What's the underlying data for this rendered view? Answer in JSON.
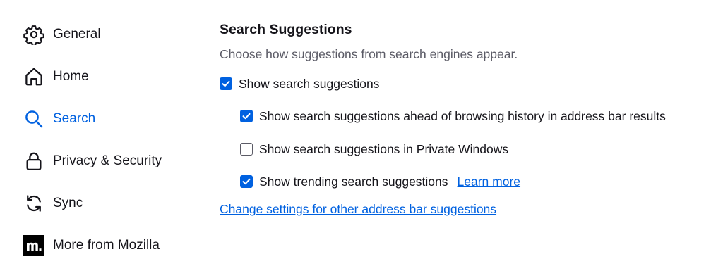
{
  "sidebar": {
    "items": [
      {
        "label": "General",
        "icon": "gear-icon",
        "selected": false
      },
      {
        "label": "Home",
        "icon": "home-icon",
        "selected": false
      },
      {
        "label": "Search",
        "icon": "search-icon",
        "selected": true
      },
      {
        "label": "Privacy & Security",
        "icon": "lock-icon",
        "selected": false
      },
      {
        "label": "Sync",
        "icon": "sync-icon",
        "selected": false
      },
      {
        "label": "More from Mozilla",
        "icon": "mozilla-logo-icon",
        "selected": false
      }
    ]
  },
  "search_suggestions": {
    "title": "Search Suggestions",
    "description": "Choose how suggestions from search engines appear.",
    "options": [
      {
        "label": "Show search suggestions",
        "checked": true
      },
      {
        "label": "Show search suggestions ahead of browsing history in address bar results",
        "checked": true
      },
      {
        "label": "Show search suggestions in Private Windows",
        "checked": false
      },
      {
        "label": "Show trending search suggestions",
        "checked": true
      }
    ],
    "learn_more_label": "Learn more",
    "change_settings_link": "Change settings for other address bar suggestions"
  },
  "colors": {
    "accent": "#0061e0",
    "text": "#15141a",
    "secondary_text": "#5b5b66"
  }
}
